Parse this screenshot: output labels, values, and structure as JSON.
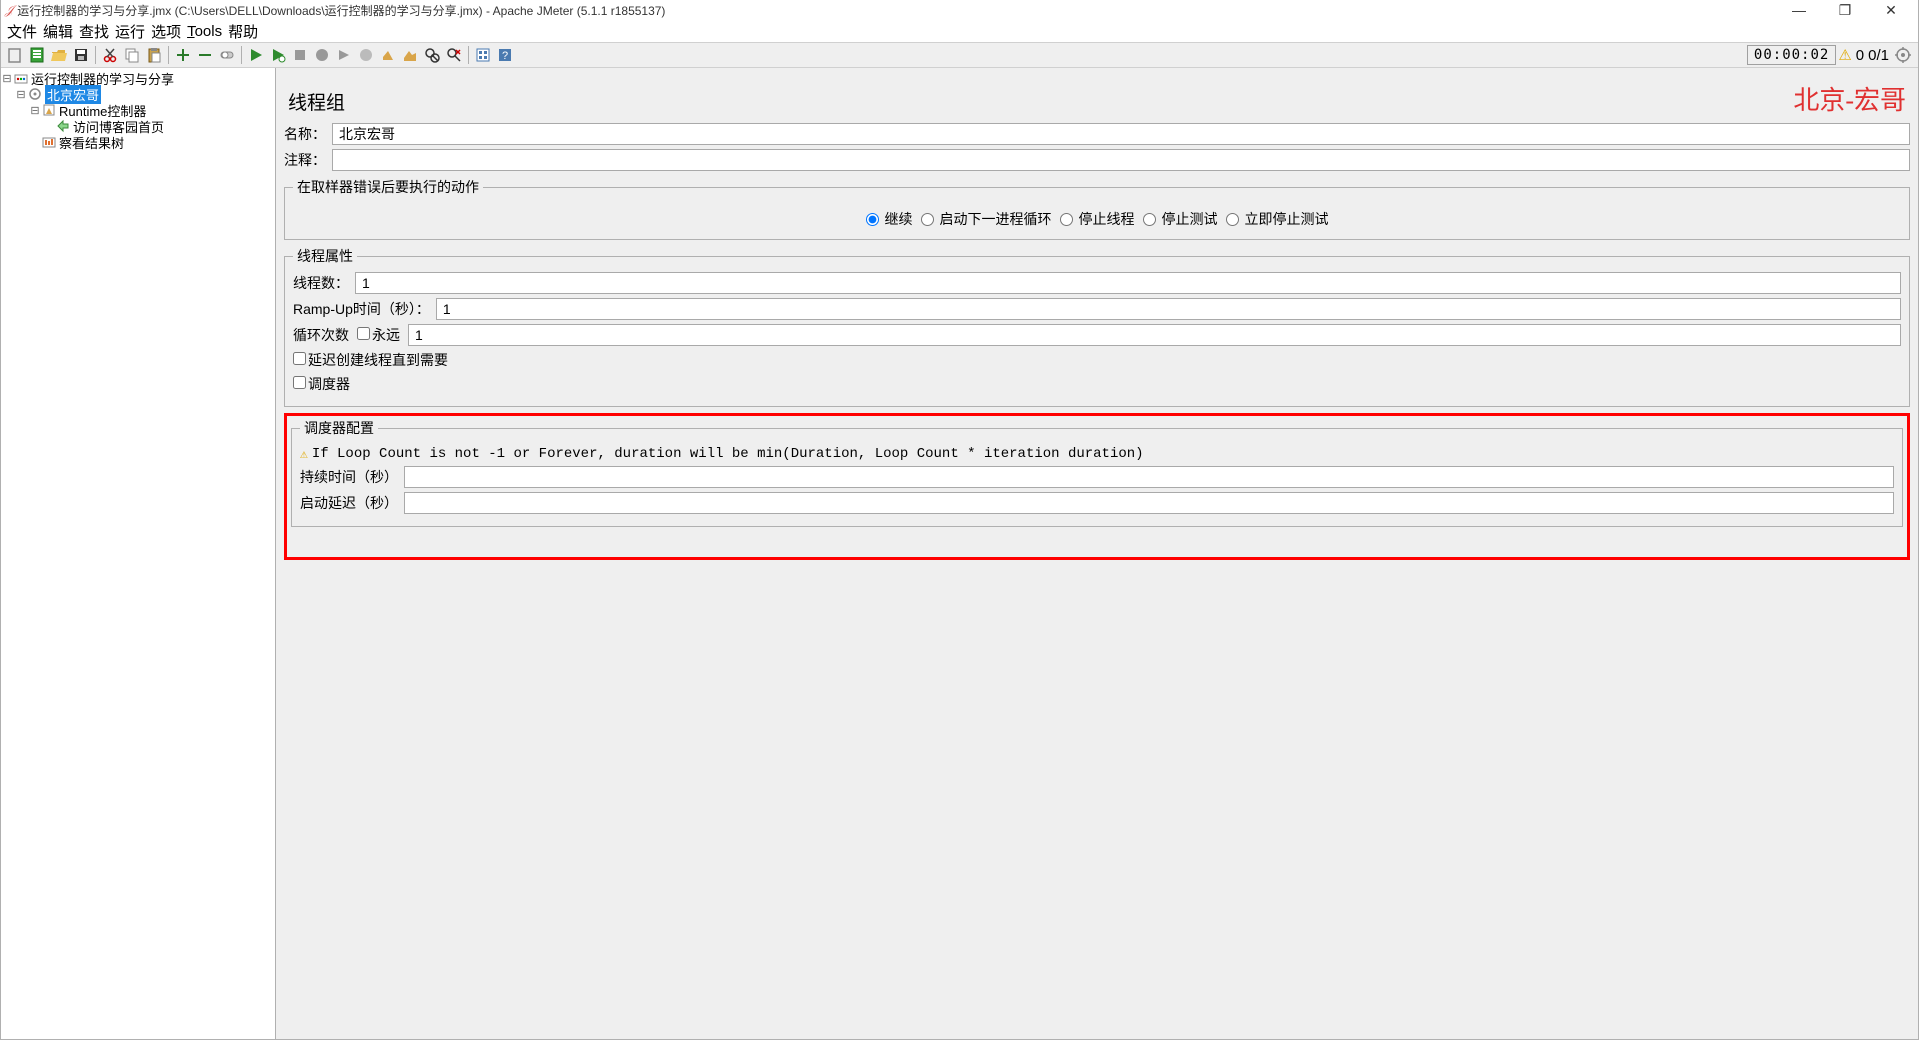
{
  "window": {
    "title": "运行控制器的学习与分享.jmx (C:\\Users\\DELL\\Downloads\\运行控制器的学习与分享.jmx) - Apache JMeter (5.1.1 r1855137)"
  },
  "menu": {
    "file": "文件",
    "edit": "编辑",
    "search": "查找",
    "run": "运行",
    "options": "选项",
    "tools": "Tools",
    "help": "帮助"
  },
  "toolbar": {
    "time": "00:00:02",
    "warn_count": "0",
    "active": "0/1"
  },
  "tree": {
    "root": "运行控制器的学习与分享",
    "selected": "北京宏哥",
    "runtime": "Runtime控制器",
    "http": "访问博客园首页",
    "listener": "察看结果树"
  },
  "panel": {
    "title": "线程组",
    "watermark": "北京-宏哥",
    "name_label": "名称：",
    "name_value": "北京宏哥",
    "comment_label": "注释：",
    "comment_value": "",
    "err_legend": "在取样器错误后要执行的动作",
    "radios": {
      "continue": "继续",
      "next_loop": "启动下一进程循环",
      "stop_thread": "停止线程",
      "stop_test": "停止测试",
      "stop_now": "立即停止测试"
    },
    "thread_legend": "线程属性",
    "threads_label": "线程数：",
    "threads_value": "1",
    "ramp_label": "Ramp-Up时间（秒）：",
    "ramp_value": "1",
    "loop_label": "循环次数",
    "forever_label": "永远",
    "loop_value": "1",
    "delay_create": "延迟创建线程直到需要",
    "scheduler_cb": "调度器",
    "sched_legend": "调度器配置",
    "sched_warn": "If Loop Count is not -1 or Forever, duration will be min(Duration, Loop Count * iteration duration)",
    "duration_label": "持续时间（秒）",
    "duration_value": "",
    "delay_label": "启动延迟（秒）",
    "delay_value": ""
  }
}
